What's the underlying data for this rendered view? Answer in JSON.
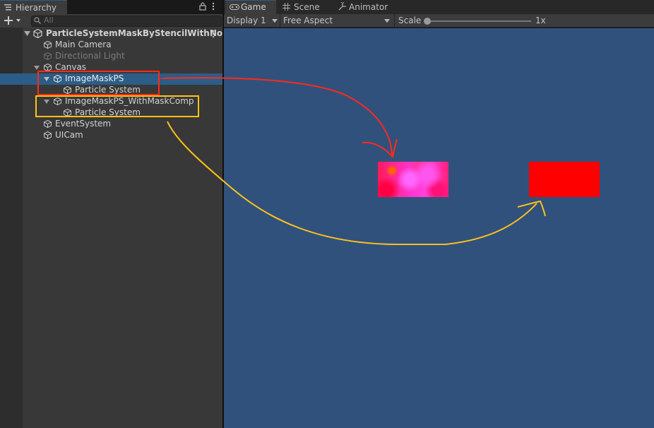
{
  "hierarchy": {
    "tab_label": "Hierarchy",
    "search_placeholder": "All",
    "root": "ParticleSystemMaskByStencilWithNotS",
    "items": [
      {
        "label": "Main Camera"
      },
      {
        "label": "Directional Light"
      },
      {
        "label": "Canvas"
      },
      {
        "label": "ImageMaskPS"
      },
      {
        "label": "Particle System"
      },
      {
        "label": "ImageMaskPS_WithMaskComp"
      },
      {
        "label": "Particle System"
      },
      {
        "label": "EventSystem"
      },
      {
        "label": "UICam"
      }
    ]
  },
  "game": {
    "tabs": [
      {
        "label": "Game",
        "icon": "gamepad-icon"
      },
      {
        "label": "Scene",
        "icon": "grid-icon"
      },
      {
        "label": "Animator",
        "icon": "animator-icon"
      }
    ],
    "display": "Display 1",
    "aspect": "Free Aspect",
    "scale_label": "Scale",
    "scale_value": "1x",
    "scale_fraction": 0.0
  },
  "colors": {
    "selection": "#2c5d87",
    "game_bg": "#31517d",
    "annotation_red": "#ff2a1a",
    "annotation_yellow": "#ffc21a"
  }
}
